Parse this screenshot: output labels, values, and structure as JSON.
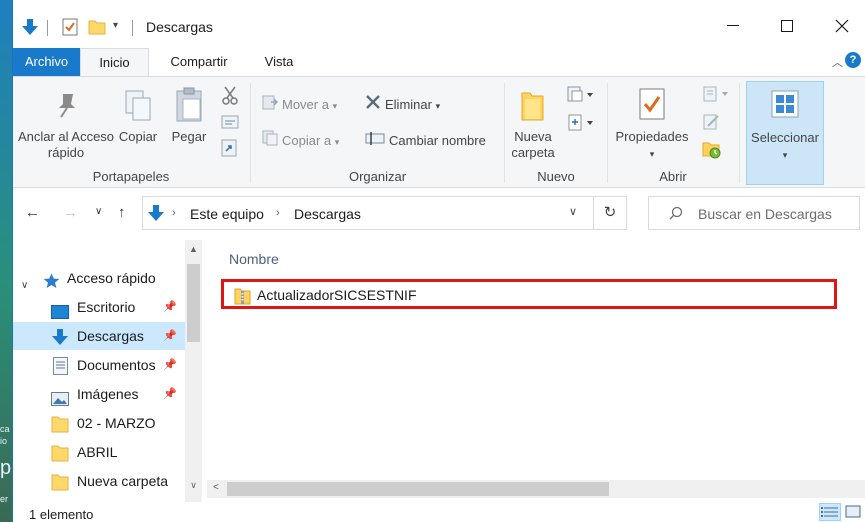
{
  "window": {
    "title": "Descargas"
  },
  "ribbon_tabs": {
    "archivo": "Archivo",
    "inicio": "Inicio",
    "compartir": "Compartir",
    "vista": "Vista"
  },
  "ribbon": {
    "portapapeles": {
      "label": "Portapapeles",
      "anclar": "Anclar al Acceso rápido",
      "copiar": "Copiar",
      "pegar": "Pegar"
    },
    "organizar": {
      "label": "Organizar",
      "mover_a": "Mover a",
      "copiar_a": "Copiar a",
      "eliminar": "Eliminar",
      "cambiar_nombre": "Cambiar nombre"
    },
    "nuevo": {
      "label": "Nuevo",
      "nueva_carpeta": "Nueva carpeta"
    },
    "abrir": {
      "label": "Abrir",
      "propiedades": "Propiedades"
    },
    "seleccionar": {
      "label": "Seleccionar"
    }
  },
  "address": {
    "breadcrumb": [
      "Este equipo",
      "Descargas"
    ],
    "search_placeholder": "Buscar en Descargas"
  },
  "nav_pane": {
    "items": [
      {
        "label": "Acceso rápido",
        "icon": "star-icon"
      },
      {
        "label": "Escritorio",
        "icon": "desktop-icon",
        "pinned": true
      },
      {
        "label": "Descargas",
        "icon": "download-icon",
        "pinned": true,
        "selected": true
      },
      {
        "label": "Documentos",
        "icon": "document-icon",
        "pinned": true
      },
      {
        "label": "Imágenes",
        "icon": "pictures-icon",
        "pinned": true
      },
      {
        "label": "02 - MARZO",
        "icon": "folder-icon"
      },
      {
        "label": "ABRIL",
        "icon": "folder-icon"
      },
      {
        "label": "Nueva carpeta",
        "icon": "folder-icon"
      }
    ]
  },
  "content": {
    "column_header": "Nombre",
    "files": [
      {
        "name": "ActualizadorSICSESTNIF",
        "icon": "zip-folder-icon",
        "highlighted": true
      }
    ]
  },
  "status": {
    "item_count": "1 elemento"
  },
  "colors": {
    "accent": "#1979ca",
    "selection": "#cce8ff",
    "highlight_border": "#e01515"
  }
}
